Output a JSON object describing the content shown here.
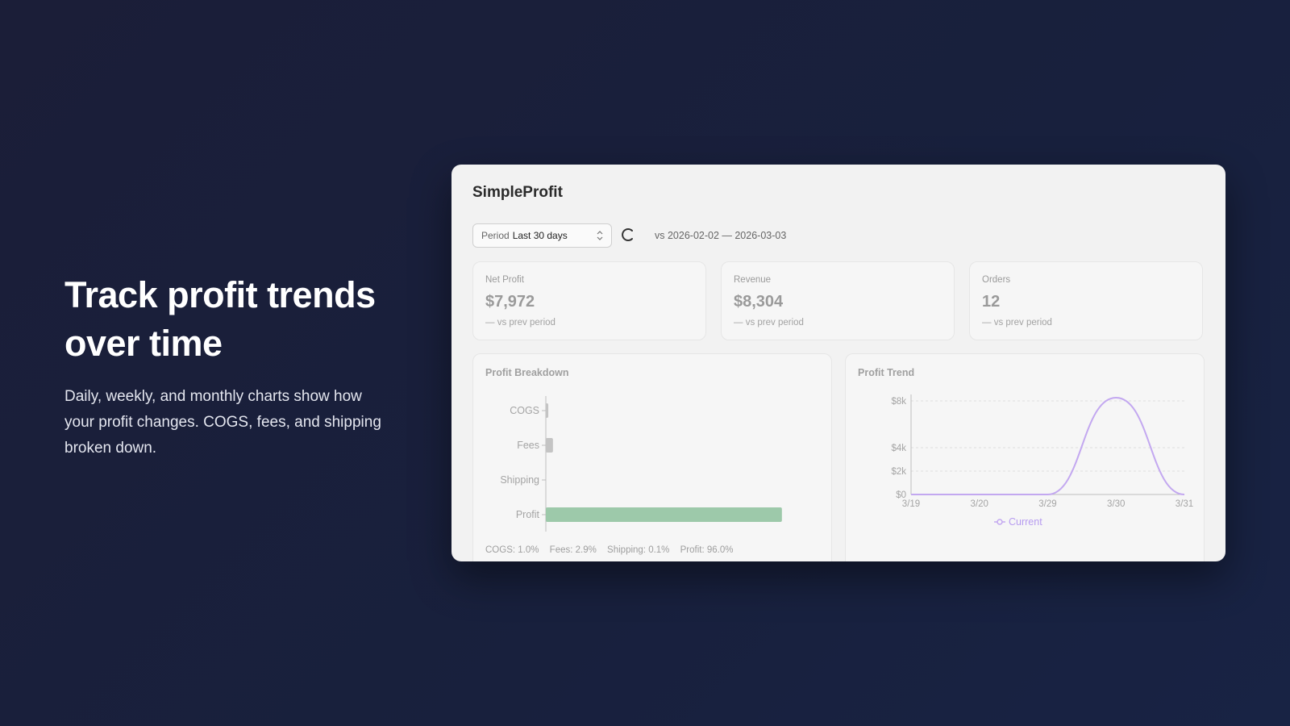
{
  "hero": {
    "title": "Track profit trends over time",
    "description": "Daily, weekly, and monthly charts show how your profit changes. COGS, fees, and shipping broken down."
  },
  "app": {
    "title": "SimpleProfit",
    "period_label": "Period",
    "period_value": "Last 30 days",
    "comparison": "vs 2026-02-02 — 2026-03-03"
  },
  "kpis": [
    {
      "label": "Net Profit",
      "value": "$7,972",
      "change": "— vs prev period"
    },
    {
      "label": "Revenue",
      "value": "$8,304",
      "change": "— vs prev period"
    },
    {
      "label": "Orders",
      "value": "12",
      "change": "— vs prev period"
    }
  ],
  "colors": {
    "bar_profit": "#9dc9aa",
    "bar_fees": "#c4c4c4",
    "trend_line": "#c3a8f0",
    "legend_text": "#b79cf0"
  },
  "chart_data": [
    {
      "type": "bar",
      "orientation": "horizontal",
      "title": "Profit Breakdown",
      "categories": [
        "COGS",
        "Fees",
        "Shipping",
        "Profit"
      ],
      "values": [
        1.0,
        2.9,
        0.1,
        96.0
      ],
      "unit": "%",
      "footer": [
        "COGS: 1.0%",
        "Fees: 2.9%",
        "Shipping: 0.1%",
        "Profit: 96.0%"
      ]
    },
    {
      "type": "line",
      "title": "Profit Trend",
      "x": [
        "3/19",
        "3/20",
        "3/29",
        "3/30",
        "3/31"
      ],
      "y_ticks": [
        "$0",
        "$2k",
        "$4k",
        "$8k"
      ],
      "ylim": [
        0,
        8000
      ],
      "series": [
        {
          "name": "Current",
          "values": [
            0,
            0,
            0,
            7972,
            0
          ]
        }
      ],
      "grid": "horizontal dashed",
      "legend": "bottom-center"
    }
  ]
}
